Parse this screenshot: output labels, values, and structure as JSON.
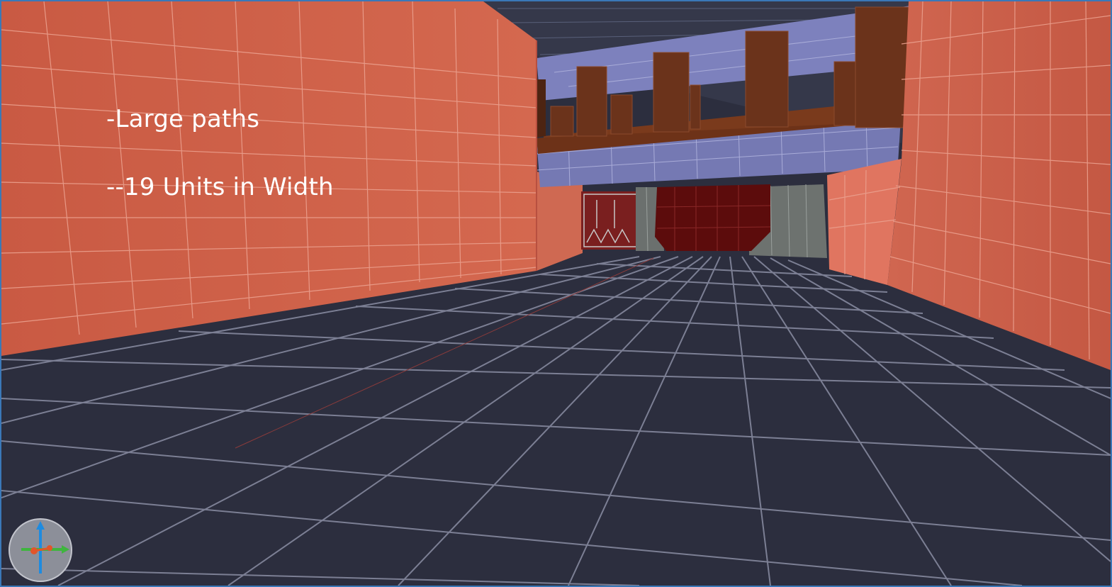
{
  "annotation": {
    "line1": "-Large paths",
    "line2": "--19 Units in Width"
  },
  "scene": {
    "wall_color": "#c95c45",
    "wall_grid_color": "#e9a18f",
    "floor_color": "#2c2e3e",
    "floor_grid_color": "#8d90a3",
    "bridge_color": "#7579b3",
    "pillar_color": "#6b331b",
    "doorway_color": "#5c0c0c",
    "concrete_color": "#6d726f"
  },
  "gizmo": {
    "axis_up_color": "#1e8be0",
    "axis_right_color": "#3fb53f",
    "axis_left_color": "#e2552a",
    "icon": "axis-gizmo-icon"
  }
}
